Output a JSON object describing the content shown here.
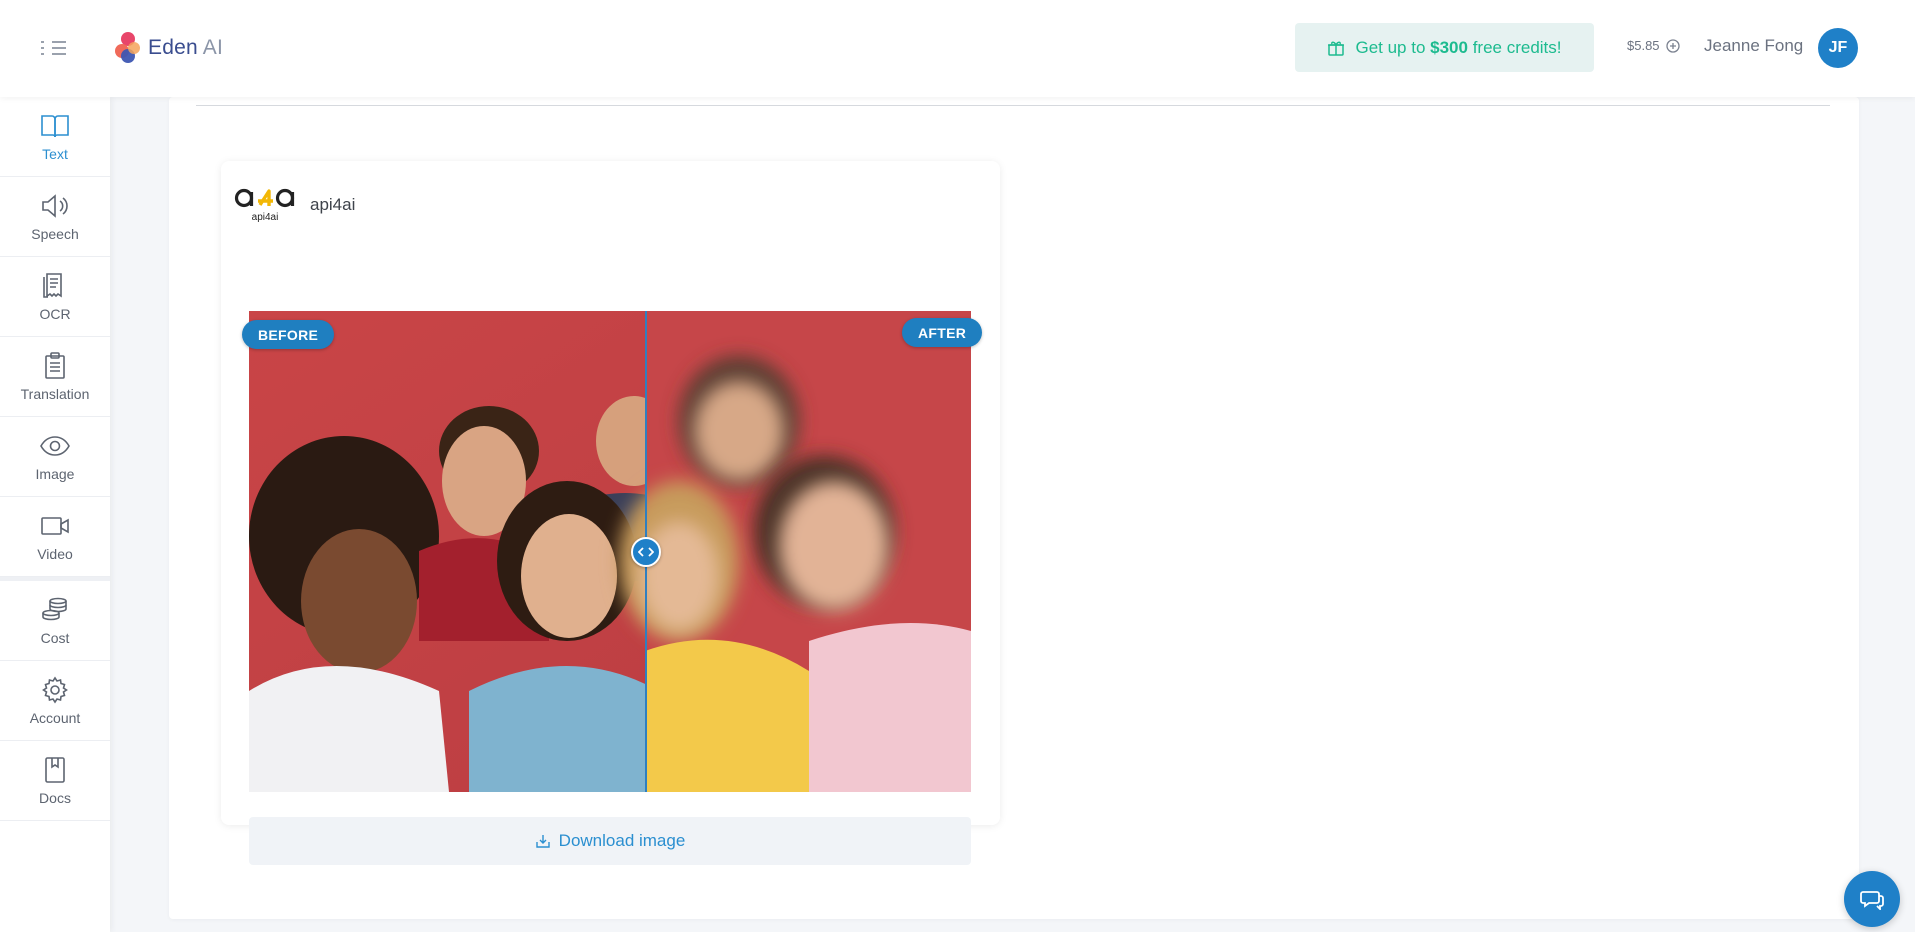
{
  "header": {
    "logo": {
      "brand": "Eden",
      "suffix": "AI"
    },
    "promo": {
      "prefix": "Get up to ",
      "amount": "$300",
      "suffix": " free credits!"
    },
    "balance": "$5.85",
    "user_name": "Jeanne Fong",
    "avatar_initials": "JF"
  },
  "sidebar": {
    "items": [
      {
        "label": "Text",
        "icon": "book-icon",
        "active": true
      },
      {
        "label": "Speech",
        "icon": "speaker-icon",
        "active": false
      },
      {
        "label": "OCR",
        "icon": "receipt-icon",
        "active": false
      },
      {
        "label": "Translation",
        "icon": "clipboard-icon",
        "active": false
      },
      {
        "label": "Image",
        "icon": "eye-icon",
        "active": false
      },
      {
        "label": "Video",
        "icon": "video-camera-icon",
        "active": false
      },
      {
        "label": "Cost",
        "icon": "coins-icon",
        "active": false
      },
      {
        "label": "Account",
        "icon": "gear-icon",
        "active": false
      },
      {
        "label": "Docs",
        "icon": "bookmark-book-icon",
        "active": false
      }
    ]
  },
  "result": {
    "provider": {
      "name": "api4ai",
      "logo_text": "api4ai"
    },
    "before_label": "BEFORE",
    "after_label": "AFTER",
    "download_label": "Download image"
  },
  "colors": {
    "accent": "#1f80c8",
    "promo_text": "#1dbb8f",
    "promo_bg": "#e6f2f1",
    "photo_background": "#c8484a"
  }
}
